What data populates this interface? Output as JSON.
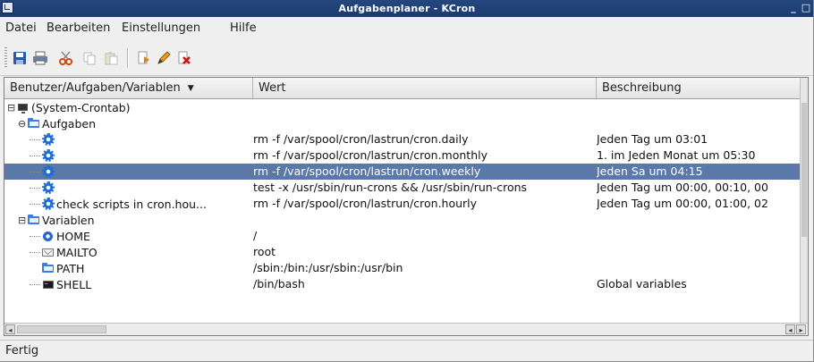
{
  "window": {
    "title": "Aufgabenplaner - KCron",
    "minimize_glyph": "_",
    "maximize_glyph": "□"
  },
  "menu": [
    "Datei",
    "Bearbeiten",
    "Einstellungen",
    "Hilfe"
  ],
  "toolbar": {
    "icons": [
      "save-icon",
      "print-icon",
      "cut-icon",
      "copy-icon",
      "paste-icon",
      "new-icon",
      "edit-icon",
      "delete-icon"
    ]
  },
  "columns": {
    "name": "Benutzer/Aufgaben/Variablen",
    "sort_indicator": "▼",
    "value": "Wert",
    "description": "Beschreibung"
  },
  "tree": {
    "root": {
      "label": "(System-Crontab)",
      "twisty": "⊟"
    },
    "tasks_folder": {
      "label": "Aufgaben",
      "twisty": "⊖"
    },
    "tasks": [
      {
        "name": "",
        "command": "rm -f /var/spool/cron/lastrun/cron.daily",
        "description": "Jeden Tag um 03:01"
      },
      {
        "name": "",
        "command": "rm -f /var/spool/cron/lastrun/cron.monthly",
        "description": "1. im Jeden Monat um 05:30"
      },
      {
        "name": "",
        "command": "rm -f /var/spool/cron/lastrun/cron.weekly",
        "description": "Jeden Sa um 04:15"
      },
      {
        "name": "",
        "command": "test -x /usr/sbin/run-crons && /usr/sbin/run-crons",
        "description": "Jeden Tag um 00:00, 00:10, 00"
      },
      {
        "name": "check scripts in cron.hou...",
        "command": "rm -f /var/spool/cron/lastrun/cron.hourly",
        "description": "Jeden Tag um 00:00, 01:00, 02"
      }
    ],
    "variables_folder": {
      "label": "Variablen",
      "twisty": "⊟"
    },
    "variables": [
      {
        "name": "HOME",
        "value": "/",
        "description": "",
        "icon": "home-icon"
      },
      {
        "name": "MAILTO",
        "value": "root",
        "description": "",
        "icon": "mail-icon"
      },
      {
        "name": "PATH",
        "value": "/sbin:/bin:/usr/sbin:/usr/bin",
        "description": "",
        "icon": "folder-icon"
      },
      {
        "name": "SHELL",
        "value": "/bin/bash",
        "description": "Global variables",
        "icon": "terminal-icon"
      }
    ]
  },
  "scroll": {
    "left": "◂",
    "right1": "◂",
    "right2": "▸"
  },
  "status": "Fertig",
  "colors": {
    "titlebar": "#1b3b70",
    "selection": "#5a79a8",
    "icon_blue": "#1d6ed2"
  }
}
